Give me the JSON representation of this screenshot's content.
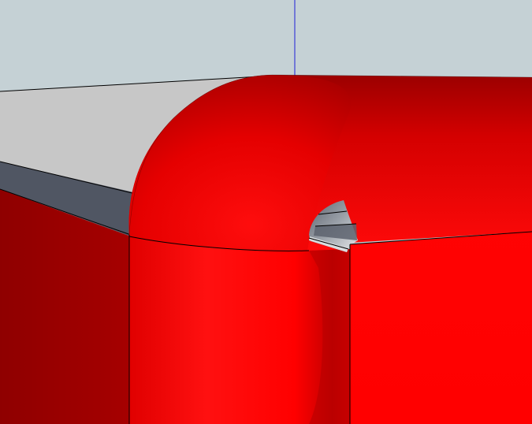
{
  "viewport": {
    "background_color": "#c5d1d5",
    "axis_color": "#1f1fd8",
    "edge_color": "#000000"
  },
  "model": {
    "body_color": "#e80000",
    "body_dark_color": "#9a0000",
    "top_face_color": "#c7c7c7",
    "shadow_band_color": "#505663",
    "notch_gray_color": "#8a8f97"
  }
}
